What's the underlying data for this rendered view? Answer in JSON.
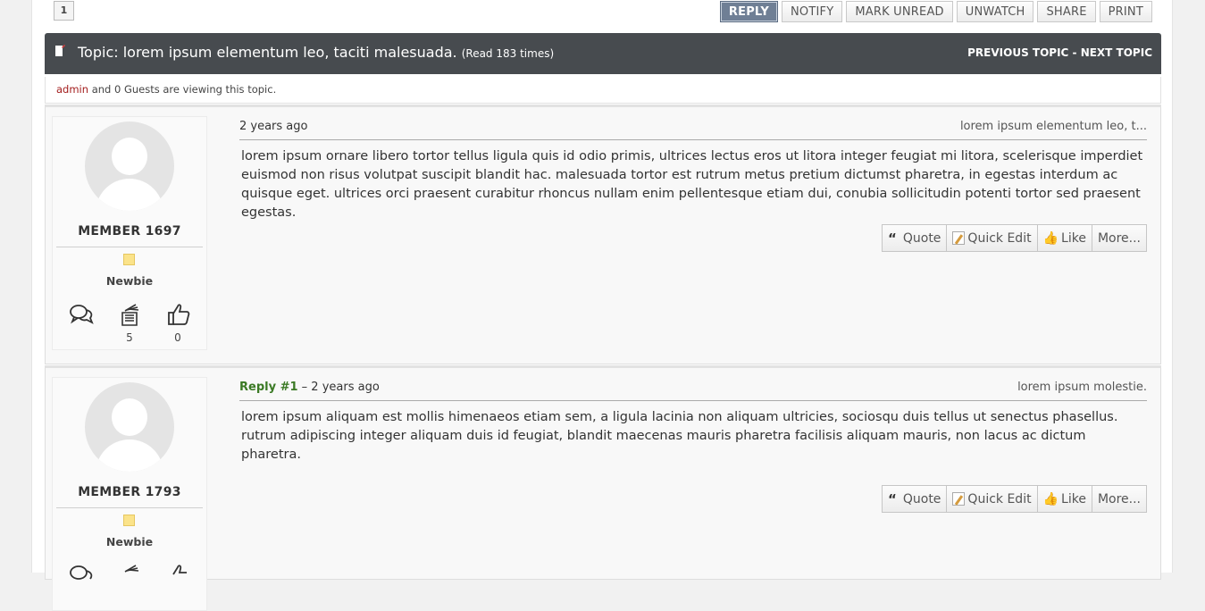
{
  "pagination": {
    "current": "1"
  },
  "actions": {
    "reply": "REPLY",
    "notify": "NOTIFY",
    "mark_unread": "MARK UNREAD",
    "unwatch": "UNWATCH",
    "share": "SHARE",
    "print": "PRINT"
  },
  "topic": {
    "title": "Topic: lorem ipsum elementum leo, taciti malesuada.",
    "reads": "(Read 183 times)",
    "prev": "PREVIOUS TOPIC",
    "separator": " - ",
    "next": "NEXT TOPIC"
  },
  "viewers": {
    "user": "admin",
    "rest": " and 0 Guests are viewing this topic."
  },
  "posts": [
    {
      "member": "MEMBER 1697",
      "rank": "Newbie",
      "posts_count": "5",
      "likes_count": "0",
      "reply_label": "",
      "time": "2 years ago",
      "subject": "lorem ipsum elementum leo, t...",
      "body": "lorem ipsum ornare libero tortor tellus ligula quis id odio primis, ultrices lectus eros ut litora integer feugiat mi litora, scelerisque imperdiet euismod non risus volutpat suscipit blandit hac. malesuada tortor est rutrum metus pretium dictumst pharetra, in egestas interdum ac quisque eget. ultrices orci praesent curabitur rhoncus nullam enim pellentesque etiam dui, conubia sollicitudin potenti tortor sed praesent egestas."
    },
    {
      "member": "MEMBER 1793",
      "rank": "Newbie",
      "posts_count": "",
      "likes_count": "",
      "reply_label": "Reply #1",
      "time": " – 2 years ago",
      "subject": "lorem ipsum molestie.",
      "body": "lorem ipsum aliquam est mollis himenaeos etiam sem, a ligula lacinia non aliquam ultricies, sociosqu duis tellus ut senectus phasellus. rutrum adipiscing integer aliquam duis id feugiat, blandit maecenas mauris pharetra facilisis aliquam mauris, non lacus ac dictum pharetra."
    }
  ],
  "post_buttons": {
    "quote": "Quote",
    "quick_edit": "Quick Edit",
    "like": "Like",
    "more": "More..."
  },
  "colors": {
    "header_bg": "#474b4f",
    "primary_button": "#6f7f95",
    "admin": "#a31d1d",
    "reply_label": "#3b7a25",
    "rank_star": "#fbe38a"
  }
}
